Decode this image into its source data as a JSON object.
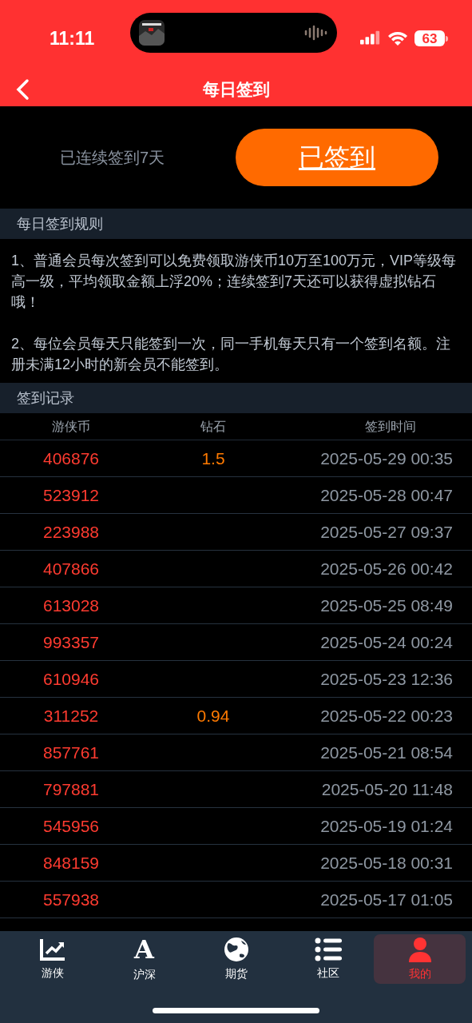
{
  "status_bar": {
    "time": "11:11",
    "battery": "63"
  },
  "header": {
    "title": "每日签到"
  },
  "checkin": {
    "streak_text": "已连续签到7天",
    "button": "已签到"
  },
  "rules": {
    "title": "每日签到规则",
    "paragraphs": [
      "1、普通会员每次签到可以免费领取游侠币10万至100万元，VIP等级每高一级，平均领取金额上浮20%；连续签到7天还可以获得虚拟钻石哦！",
      "2、每位会员每天只能签到一次，同一手机每天只有一个签到名额。注册未满12小时的新会员不能签到。"
    ]
  },
  "records": {
    "title": "签到记录",
    "columns": [
      "游侠币",
      "钻石",
      "签到时间"
    ],
    "rows": [
      {
        "coins": "406876",
        "diamonds": "1.5",
        "time": "2025-05-29 00:35"
      },
      {
        "coins": "523912",
        "time": "2025-05-28 00:47"
      },
      {
        "coins": "223988",
        "time": "2025-05-27 09:37"
      },
      {
        "coins": "407866",
        "time": "2025-05-26 00:42"
      },
      {
        "coins": "613028",
        "time": "2025-05-25 08:49"
      },
      {
        "coins": "993357",
        "time": "2025-05-24 00:24"
      },
      {
        "coins": "610946",
        "time": "2025-05-23 12:36"
      },
      {
        "coins": "311252",
        "diamonds": "0.94",
        "time": "2025-05-22 00:23"
      },
      {
        "coins": "857761",
        "time": "2025-05-21 08:54"
      },
      {
        "coins": "797881",
        "time": "2025-05-20 11:48"
      },
      {
        "coins": "545956",
        "time": "2025-05-19 01:24"
      },
      {
        "coins": "848159",
        "time": "2025-05-18 00:31"
      },
      {
        "coins": "557938",
        "time": "2025-05-17 01:05"
      }
    ]
  },
  "tab_bar": [
    {
      "kind": "chart",
      "label": "游侠",
      "selected": false
    },
    {
      "kind": "letter",
      "label": "沪深",
      "glyph": "A",
      "selected": false
    },
    {
      "kind": "globe",
      "label": "期货",
      "selected": false
    },
    {
      "kind": "list",
      "label": "社区",
      "selected": false
    },
    {
      "kind": "person",
      "label": "我的",
      "selected": true
    }
  ]
}
